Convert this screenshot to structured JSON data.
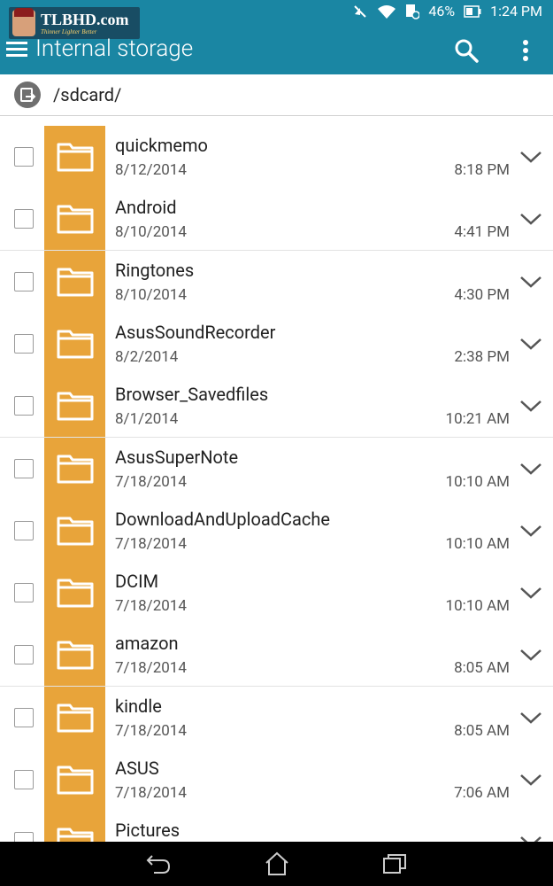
{
  "status": {
    "battery": "46%",
    "time": "1:24 PM"
  },
  "watermark": {
    "brand": "TLBHD.com",
    "tagline": "Thinner Lighter Better"
  },
  "appbar": {
    "title": "Internal storage"
  },
  "path": {
    "current": "/sdcard/"
  },
  "files": [
    {
      "name": "quickmemo",
      "date": "8/12/2014",
      "time": "8:18 PM"
    },
    {
      "name": "Android",
      "date": "8/10/2014",
      "time": "4:41 PM"
    },
    {
      "name": "Ringtones",
      "date": "8/10/2014",
      "time": "4:30 PM"
    },
    {
      "name": "AsusSoundRecorder",
      "date": "8/2/2014",
      "time": "2:38 PM"
    },
    {
      "name": "Browser_Savedfiles",
      "date": "8/1/2014",
      "time": "10:21 AM"
    },
    {
      "name": "AsusSuperNote",
      "date": "7/18/2014",
      "time": "10:10 AM"
    },
    {
      "name": "DownloadAndUploadCache",
      "date": "7/18/2014",
      "time": "10:10 AM"
    },
    {
      "name": "DCIM",
      "date": "7/18/2014",
      "time": "10:10 AM"
    },
    {
      "name": "amazon",
      "date": "7/18/2014",
      "time": "8:05 AM"
    },
    {
      "name": "kindle",
      "date": "7/18/2014",
      "time": "8:05 AM"
    },
    {
      "name": "ASUS",
      "date": "7/18/2014",
      "time": "7:06 AM"
    },
    {
      "name": "Pictures",
      "date": "",
      "time": ""
    }
  ],
  "colors": {
    "appbar": "#1a86a3",
    "folder": "#e8a43a"
  }
}
